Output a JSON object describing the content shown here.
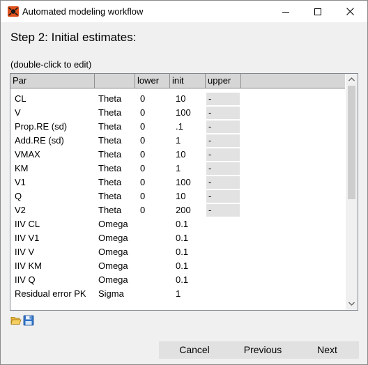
{
  "window": {
    "title": "Automated modeling workflow"
  },
  "step_title": "Step 2: Initial estimates:",
  "hint": "(double-click to edit)",
  "table": {
    "headers": [
      "Par",
      "",
      "lower",
      "init",
      "upper"
    ],
    "rows": [
      {
        "par": "CL",
        "type": "Theta",
        "lower": "0",
        "init": "10",
        "upper": "-"
      },
      {
        "par": "V",
        "type": "Theta",
        "lower": "0",
        "init": "100",
        "upper": "-"
      },
      {
        "par": "Prop.RE (sd)",
        "type": "Theta",
        "lower": "0",
        "init": ".1",
        "upper": "-"
      },
      {
        "par": "Add.RE (sd)",
        "type": "Theta",
        "lower": "0",
        "init": "1",
        "upper": "-"
      },
      {
        "par": "VMAX",
        "type": "Theta",
        "lower": "0",
        "init": "10",
        "upper": "-"
      },
      {
        "par": "KM",
        "type": "Theta",
        "lower": "0",
        "init": "1",
        "upper": "-"
      },
      {
        "par": "V1",
        "type": "Theta",
        "lower": "0",
        "init": "100",
        "upper": "-"
      },
      {
        "par": "Q",
        "type": "Theta",
        "lower": "0",
        "init": "10",
        "upper": "-"
      },
      {
        "par": "V2",
        "type": "Theta",
        "lower": "0",
        "init": "200",
        "upper": "-"
      },
      {
        "par": "IIV CL",
        "type": "Omega",
        "lower": "",
        "init": "0.1",
        "upper": ""
      },
      {
        "par": "IIV V1",
        "type": "Omega",
        "lower": "",
        "init": "0.1",
        "upper": ""
      },
      {
        "par": "IIV V",
        "type": "Omega",
        "lower": "",
        "init": "0.1",
        "upper": ""
      },
      {
        "par": "IIV KM",
        "type": "Omega",
        "lower": "",
        "init": "0.1",
        "upper": ""
      },
      {
        "par": "IIV Q",
        "type": "Omega",
        "lower": "",
        "init": "0.1",
        "upper": ""
      },
      {
        "par": "Residual error PK",
        "type": "Sigma",
        "lower": "",
        "init": "1",
        "upper": ""
      }
    ]
  },
  "toolbar": {
    "open_icon": "folder-open-icon",
    "save_icon": "save-disk-icon"
  },
  "footer": {
    "cancel": "Cancel",
    "previous": "Previous",
    "next": "Next"
  },
  "colors": {
    "header_bg": "#d6d6d6",
    "upper_cell_bg": "#e2e2e2",
    "app_icon": "#e0521c"
  }
}
